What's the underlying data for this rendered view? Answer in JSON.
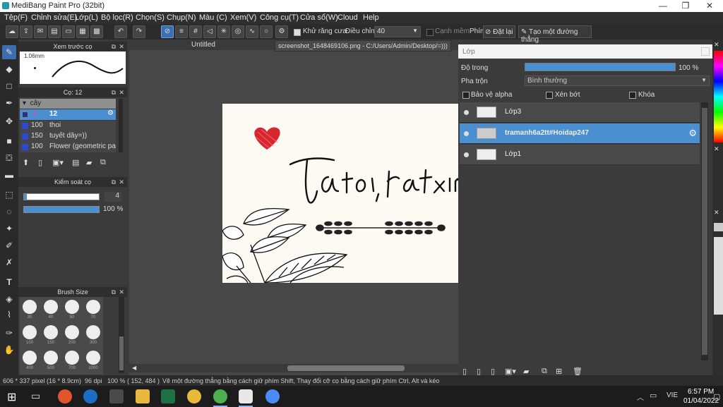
{
  "titlebar": {
    "title": "MediBang Paint Pro (32bit)",
    "minimize": "—",
    "maximize": "❐",
    "close": "✕"
  },
  "menus": [
    "Tệp(F)",
    "Chỉnh sửa(E)",
    "Lớp(L)",
    "Bộ lọc(R)",
    "Chọn(S)",
    "Chụp(N)",
    "Màu (C)",
    "Xem(V)",
    "Công cụ(T)",
    "Cửa sổ(W)",
    "Cloud",
    "Help"
  ],
  "toolbar": {
    "antialias_label": "Khử răng cưa",
    "adjust_label": "Điều chỉnh",
    "adjust_value": "40",
    "smooth_edge_label": "Cạnh mềm",
    "key_label": "Phím",
    "reset_label": "Đặt lại",
    "straight_line_label": "Tạo một đường thẳng"
  },
  "preview_panel": {
    "title": "Xem trước cọ",
    "size_label": "1.06mm"
  },
  "brush_panel": {
    "title": "Cọ: 12",
    "group": "cây",
    "items": [
      {
        "size": "4",
        "name": "12",
        "color": "#1d3a8a",
        "selected": true
      },
      {
        "size": "100",
        "name": "thoi",
        "color": "#2a4bd0"
      },
      {
        "size": "150",
        "name": "tuyết dây=))",
        "color": "#2a4bd0"
      },
      {
        "size": "100",
        "name": "Flower (geometric patt",
        "color": "#2a4bd0"
      }
    ]
  },
  "control_panel": {
    "title": "Kiểm soát cọ",
    "size_value": "4",
    "opacity_value": "100 %",
    "opacity_fraction": 1.0
  },
  "brush_size_panel": {
    "title": "Brush Size",
    "sizes": [
      "30",
      "40",
      "50",
      "70",
      "100",
      "150",
      "200",
      "300",
      "400",
      "500",
      "700",
      "1000"
    ]
  },
  "canvas": {
    "tab_label": "Untitled"
  },
  "tooltip": {
    "text": "screenshot_1648469106.png - C:/Users/Admin/Desktop/=)))"
  },
  "layer_panel": {
    "title": "Lớp",
    "opacity_label": "Độ trong",
    "opacity_value": "100 %",
    "opacity_fraction": 1.0,
    "blend_label": "Pha trộn",
    "blend_value": "Bình thường",
    "protect_alpha": "Bảo vệ alpha",
    "clipping": "Xén bớt",
    "lock": "Khóa",
    "layers": [
      {
        "name": "Lớp3",
        "selected": false
      },
      {
        "name": "tramanh6a2tt#Hoidap247",
        "selected": true
      },
      {
        "name": "Lớp1",
        "selected": false
      }
    ]
  },
  "status": {
    "size": "606 * 337 pixel",
    "size_cm": "(16 * 8.9cm)",
    "dpi": "96 dpi",
    "zoom": "100 %",
    "coords": "( 152, 484 )",
    "hint": "Vẽ một đường thẳng bằng cách giữ phím Shift, Thay đổi cỡ cọ bằng cách giữ phím Ctrl, Alt và kéo"
  },
  "taskbar": {
    "time": "6:57 PM",
    "date": "01/04/2022",
    "lang": "VIE"
  },
  "colors": {
    "accent": "#4a90d0",
    "heart": "#d8262f",
    "panel": "#3b3b3b"
  }
}
